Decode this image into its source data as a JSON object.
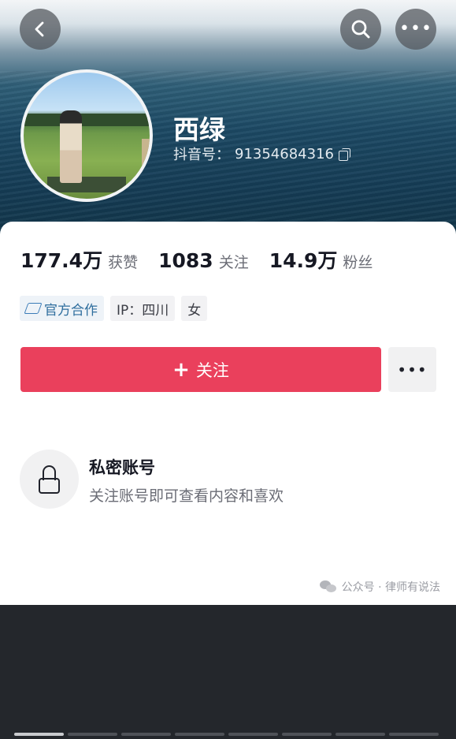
{
  "header": {
    "buttons": {
      "back_icon": "chevron-left-icon",
      "search_icon": "search-icon",
      "more_icon": "more-horizontal-icon",
      "more_glyph": "•••"
    }
  },
  "profile": {
    "name": "西绿",
    "douyin_id_label": "抖音号：",
    "douyin_id": "91354684316"
  },
  "stats": [
    {
      "value": "177.4万",
      "label": "获赞"
    },
    {
      "value": "1083",
      "label": "关注"
    },
    {
      "value": "14.9万",
      "label": "粉丝"
    }
  ],
  "tags": [
    {
      "text": "官方合作",
      "icon": "official-cooperation-icon"
    },
    {
      "text": "IP：四川"
    },
    {
      "text": "女"
    }
  ],
  "actions": {
    "follow_plus": "+",
    "follow_label": "关注",
    "more_glyph": "•••"
  },
  "private_notice": {
    "title": "私密账号",
    "description": "关注账号即可查看内容和喜欢"
  },
  "watermark": {
    "text": "公众号 · 律师有说法"
  },
  "progress": {
    "segments": 8,
    "active_index": 0
  },
  "colors": {
    "accent": "#ea405c",
    "text_primary": "#161823",
    "text_secondary": "#6b6d76",
    "official_blue": "#2f6e9e"
  }
}
